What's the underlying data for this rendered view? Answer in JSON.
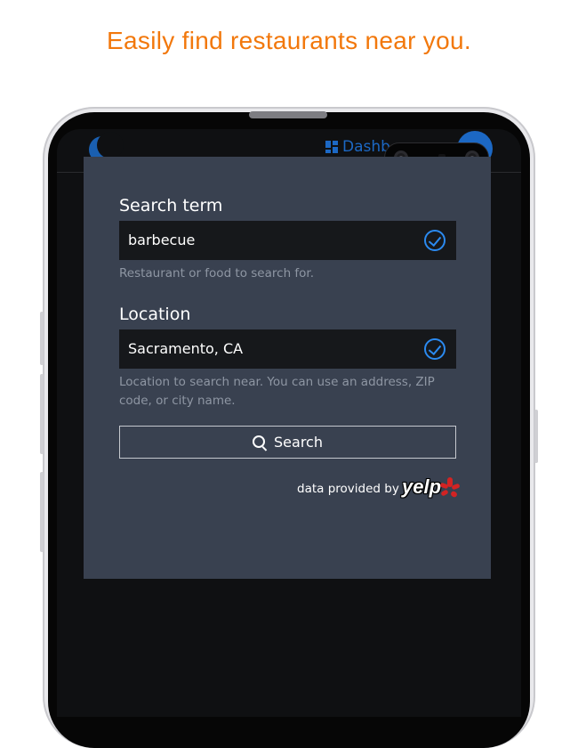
{
  "headline": "Easily find restaurants near you.",
  "colors": {
    "headline": "#f2780c",
    "accent": "#2b8af0",
    "dialog": "#394150",
    "yelp_red": "#d32323"
  },
  "background_app": {
    "nav_label": "Dashb",
    "nav_icon": "dashboard-grid-icon",
    "logo_icon": "moon-icon"
  },
  "dialog": {
    "search_term": {
      "label": "Search term",
      "value": "barbecue",
      "hint": "Restaurant or food to search for.",
      "valid_icon": "check-circle-icon"
    },
    "location": {
      "label": "Location",
      "value": "Sacramento, CA",
      "hint": "Location to search near. You can use an address, ZIP code, or city name.",
      "valid_icon": "check-circle-icon"
    },
    "search_button": {
      "label": "Search",
      "icon": "search-icon"
    },
    "attribution": {
      "text": "data provided by",
      "brand": "yelp"
    }
  }
}
